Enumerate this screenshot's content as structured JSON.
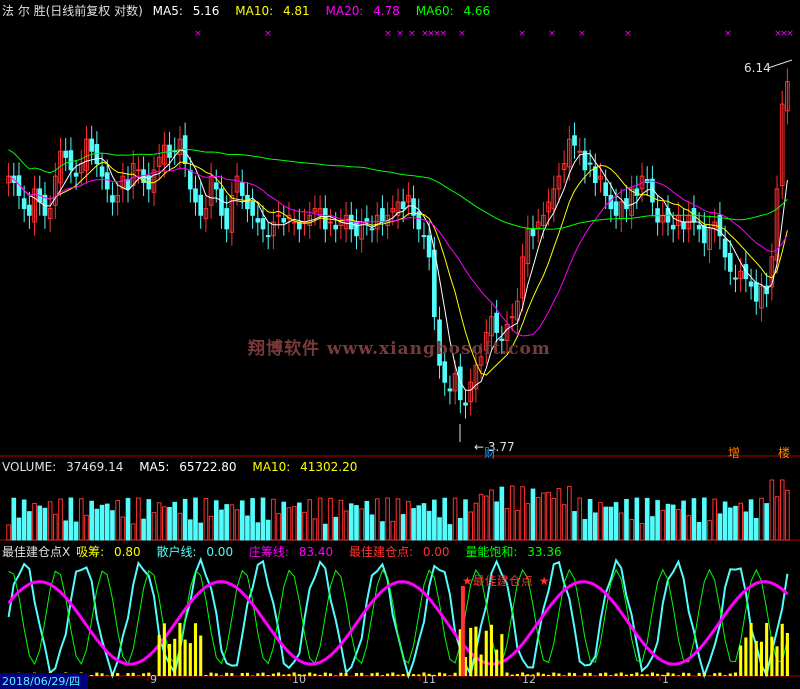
{
  "colors": {
    "up": "#ff3232",
    "down": "#54fcfc",
    "ma5": "#ffffff",
    "ma10": "#ffff00",
    "ma20": "#ff00ff",
    "ma60": "#00ff00",
    "grid": "#b00000",
    "xinfo": "#ff00ff"
  },
  "header": {
    "title": "法 尔 胜(日线前复权 对数)",
    "ma5_label": "MA5:",
    "ma5_value": "5.16",
    "ma10_label": "MA10:",
    "ma10_value": "4.81",
    "ma20_label": "MA20:",
    "ma20_value": "4.78",
    "ma60_label": "MA60:",
    "ma60_value": "4.66"
  },
  "volume_header": {
    "label": "VOLUME:",
    "value": "37469.14",
    "ma5_label": "MA5:",
    "ma5_value": "65722.80",
    "ma10_label": "MA10:",
    "ma10_value": "41302.20"
  },
  "indicator_header": {
    "name": "最佳建仓点X",
    "xichou_label": "吸筹:",
    "xichou_value": "0.80",
    "sanhu_label": "散户线:",
    "sanhu_value": "0.00",
    "zhuang_label": "庄筹线:",
    "zhuang_value": "83.40",
    "best_label": "最佳建仓点:",
    "best_value": "0.00",
    "liang_label": "量能饱和:",
    "liang_value": "33.36"
  },
  "annotations": {
    "high_price": "6.14",
    "low_price": "3.77",
    "caicon_low": "财",
    "zeng": "增",
    "lou": "楼",
    "best_entry_label": "最佳建仓点",
    "watermark": "翔博软件 www.xiangbosoft.com"
  },
  "date_axis": {
    "start_date": "2018/06/29/四",
    "month_labels": [
      "9",
      "10",
      "11",
      "12",
      "1"
    ]
  },
  "chart_data": [
    {
      "type": "candlestick",
      "title": "法 尔 胜(日线前复权 对数)",
      "notes": "Approximate daily OHLC read from the log-price chart (2018/06/29 onward).",
      "closes": [
        5.3,
        5.25,
        5.15,
        5.05,
        5.0,
        5.2,
        5.1,
        5.0,
        5.05,
        5.3,
        5.5,
        5.45,
        5.35,
        5.3,
        5.4,
        5.6,
        5.5,
        5.4,
        5.3,
        5.2,
        5.1,
        5.15,
        5.3,
        5.2,
        5.4,
        5.35,
        5.25,
        5.2,
        5.35,
        5.45,
        5.55,
        5.45,
        5.5,
        5.6,
        5.4,
        5.2,
        5.1,
        5.0,
        5.05,
        5.3,
        5.2,
        5.0,
        4.9,
        5.15,
        5.3,
        5.15,
        5.05,
        5.0,
        4.95,
        4.9,
        4.85,
        4.95,
        5.0,
        4.95,
        5.0,
        4.95,
        4.9,
        4.95,
        5.0,
        5.05,
        5.05,
        4.9,
        4.95,
        4.9,
        4.95,
        5.0,
        4.9,
        4.85,
        4.95,
        4.95,
        4.9,
        5.0,
        4.95,
        5.0,
        5.05,
        5.1,
        5.05,
        5.15,
        5.0,
        4.9,
        4.85,
        4.7,
        4.3,
        4.0,
        3.9,
        3.85,
        3.95,
        3.8,
        3.77,
        3.9,
        4.0,
        4.05,
        4.2,
        4.3,
        4.2,
        4.15,
        4.25,
        4.3,
        4.4,
        4.7,
        4.9,
        4.85,
        4.95,
        5.0,
        5.1,
        5.2,
        5.3,
        5.4,
        5.6,
        5.55,
        5.5,
        5.35,
        5.4,
        5.25,
        5.3,
        5.15,
        5.05,
        5.0,
        5.1,
        5.05,
        5.2,
        5.15,
        5.3,
        5.25,
        5.1,
        4.95,
        5.0,
        4.95,
        4.9,
        5.0,
        4.9,
        5.0,
        4.95,
        4.9,
        4.8,
        4.9,
        4.95,
        4.85,
        4.7,
        4.6,
        4.55,
        4.6,
        4.55,
        4.5,
        4.4,
        4.5,
        4.45,
        4.7,
        5.2,
        5.9,
        6.1
      ],
      "y_label_marks": [
        "6.14",
        "3.77"
      ],
      "series": [
        {
          "name": "MA5",
          "last": 5.16
        },
        {
          "name": "MA10",
          "last": 4.81
        },
        {
          "name": "MA20",
          "last": 4.78
        },
        {
          "name": "MA60",
          "last": 4.66
        }
      ]
    },
    {
      "type": "bar",
      "title": "VOLUME",
      "series": [
        {
          "name": "VOLUME",
          "last": 37469.14
        },
        {
          "name": "MA5",
          "last": 65722.8
        },
        {
          "name": "MA10",
          "last": 41302.2
        }
      ]
    },
    {
      "type": "line",
      "title": "最佳建仓点X",
      "series": [
        {
          "name": "吸筹",
          "last": 0.8
        },
        {
          "name": "散户线",
          "last": 0.0
        },
        {
          "name": "庄筹线",
          "last": 83.4
        },
        {
          "name": "最佳建仓点",
          "last": 0.0
        },
        {
          "name": "量能饱和",
          "last": 33.36
        }
      ]
    }
  ]
}
